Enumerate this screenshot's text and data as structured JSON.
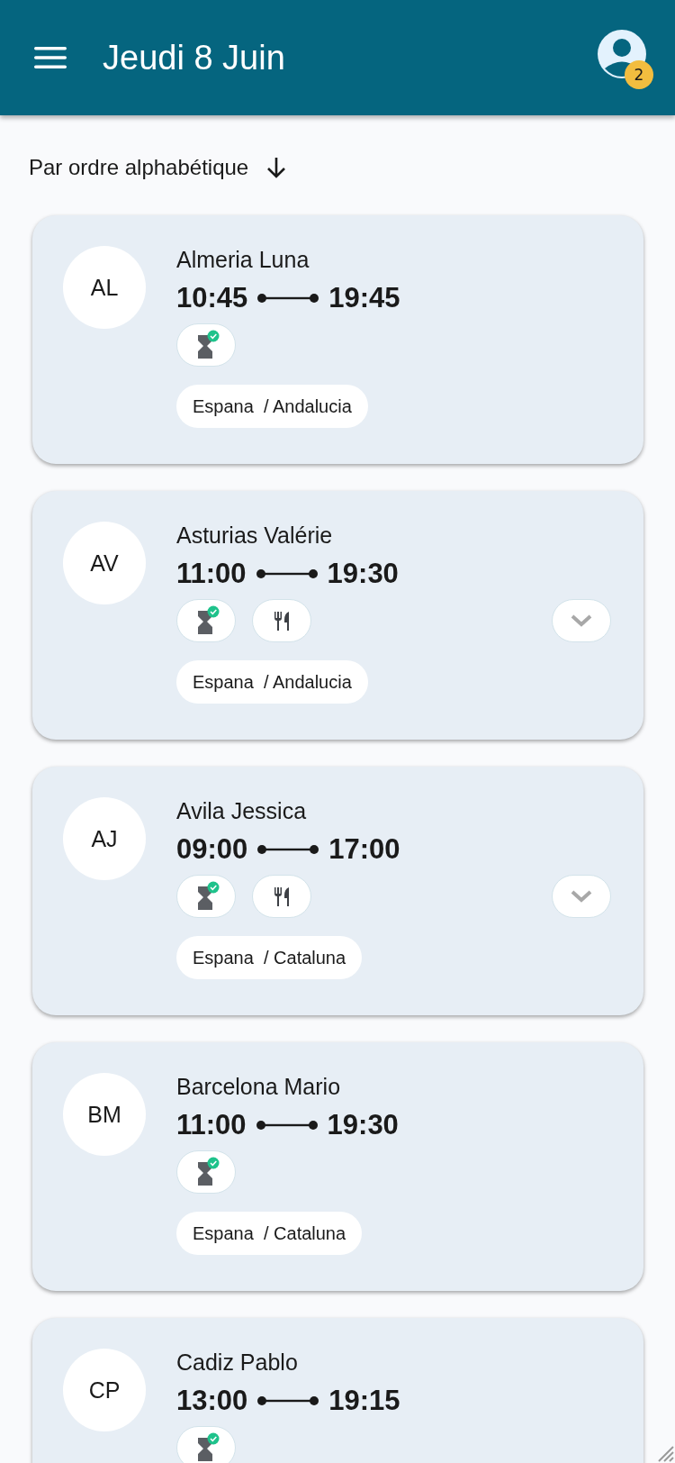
{
  "header": {
    "title": "Jeudi 8 Juin",
    "notification_count": "2"
  },
  "sort": {
    "label": "Par ordre alphabétique"
  },
  "employees": [
    {
      "initials": "AL",
      "name": "Almeria Luna",
      "start": "10:45",
      "end": "19:45",
      "badges": [
        {
          "kind": "hourglass",
          "validated": true
        }
      ],
      "expandable": false,
      "location": "Espana  / Andalucia"
    },
    {
      "initials": "AV",
      "name": "Asturias Valérie",
      "start": "11:00",
      "end": "19:30",
      "badges": [
        {
          "kind": "hourglass",
          "validated": true
        },
        {
          "kind": "meal",
          "validated": false
        }
      ],
      "expandable": true,
      "location": "Espana  / Andalucia"
    },
    {
      "initials": "AJ",
      "name": "Avila Jessica",
      "start": "09:00",
      "end": "17:00",
      "badges": [
        {
          "kind": "hourglass",
          "validated": true
        },
        {
          "kind": "meal",
          "validated": false
        }
      ],
      "expandable": true,
      "location": "Espana  / Cataluna"
    },
    {
      "initials": "BM",
      "name": "Barcelona Mario",
      "start": "11:00",
      "end": "19:30",
      "badges": [
        {
          "kind": "hourglass",
          "validated": true
        }
      ],
      "expandable": false,
      "location": "Espana  / Cataluna"
    },
    {
      "initials": "CP",
      "name": "Cadiz Pablo",
      "start": "13:00",
      "end": "19:15",
      "badges": [
        {
          "kind": "hourglass",
          "validated": true
        }
      ],
      "expandable": false
    }
  ]
}
